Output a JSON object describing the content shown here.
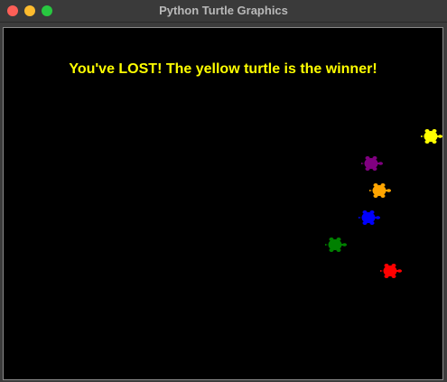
{
  "window": {
    "title": "Python Turtle Graphics"
  },
  "canvas": {
    "background": "#000000",
    "message": "You've LOST! The yellow turtle is the winner!",
    "message_color": "#ffff00"
  },
  "turtles": [
    {
      "name": "yellow",
      "color": "#ffff00",
      "icon": "turtle-icon"
    },
    {
      "name": "purple",
      "color": "#800080",
      "icon": "turtle-icon"
    },
    {
      "name": "orange",
      "color": "#ffa500",
      "icon": "turtle-icon"
    },
    {
      "name": "blue",
      "color": "#0000ff",
      "icon": "turtle-icon"
    },
    {
      "name": "green",
      "color": "#008000",
      "icon": "turtle-icon"
    },
    {
      "name": "red",
      "color": "#ff0000",
      "icon": "turtle-icon"
    }
  ],
  "controls": {
    "close_color": "#fe5f57",
    "minimize_color": "#febc2e",
    "zoom_color": "#28c840"
  }
}
